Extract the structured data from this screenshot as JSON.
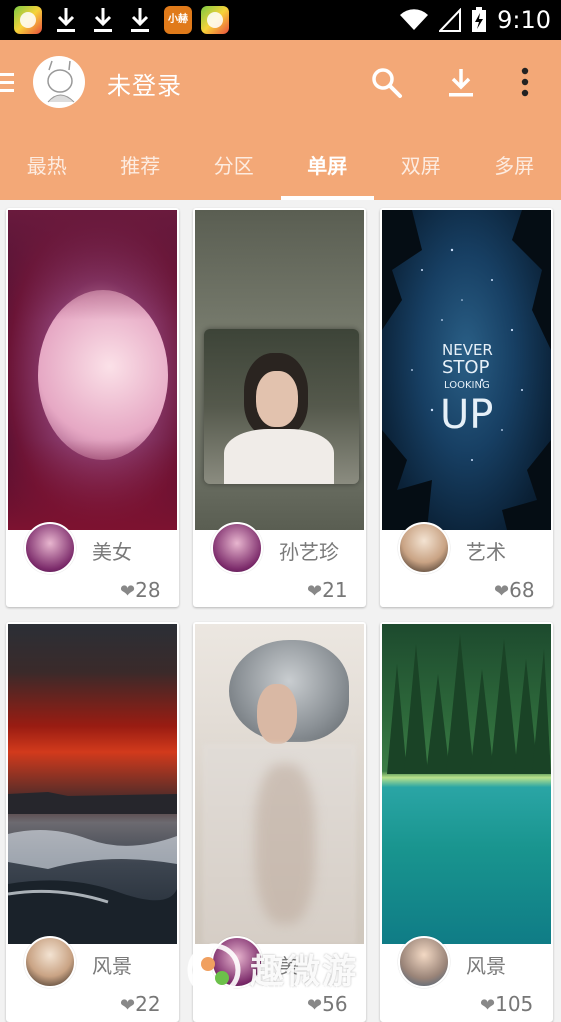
{
  "status_bar": {
    "time": "9:10",
    "icons": [
      "app-icon-green",
      "download-icon",
      "download-icon",
      "download-icon",
      "app-icon-orange-xiaolv",
      "app-icon-green",
      "wifi-icon",
      "signal-icon",
      "battery-charging-icon"
    ],
    "small_app_label": "小赫"
  },
  "header": {
    "login_label": "未登录",
    "icons": [
      "menu-icon",
      "avatar",
      "search-icon",
      "download-icon",
      "more-vertical-icon"
    ],
    "color": "#f3a877"
  },
  "tabs": [
    {
      "label": "最热",
      "active": false
    },
    {
      "label": "推荐",
      "active": false
    },
    {
      "label": "分区",
      "active": false
    },
    {
      "label": "单屏",
      "active": true
    },
    {
      "label": "双屏",
      "active": false
    },
    {
      "label": "多屏",
      "active": false
    }
  ],
  "cards": [
    {
      "title": "美女",
      "likes": "28"
    },
    {
      "title": "孙艺珍",
      "likes": "21"
    },
    {
      "title": "艺术",
      "likes": "68"
    },
    {
      "title": "风景",
      "likes": "22"
    },
    {
      "title": "美",
      "likes": "56"
    },
    {
      "title": "风景",
      "likes": "105"
    }
  ],
  "art_text": {
    "line1": "NEVER",
    "line2": "STOP",
    "line3": "LOOKING",
    "line4": "UP"
  },
  "watermark": {
    "text": "趣微游",
    "sub": "QUWEIYOU"
  },
  "heart_glyph": "❤"
}
